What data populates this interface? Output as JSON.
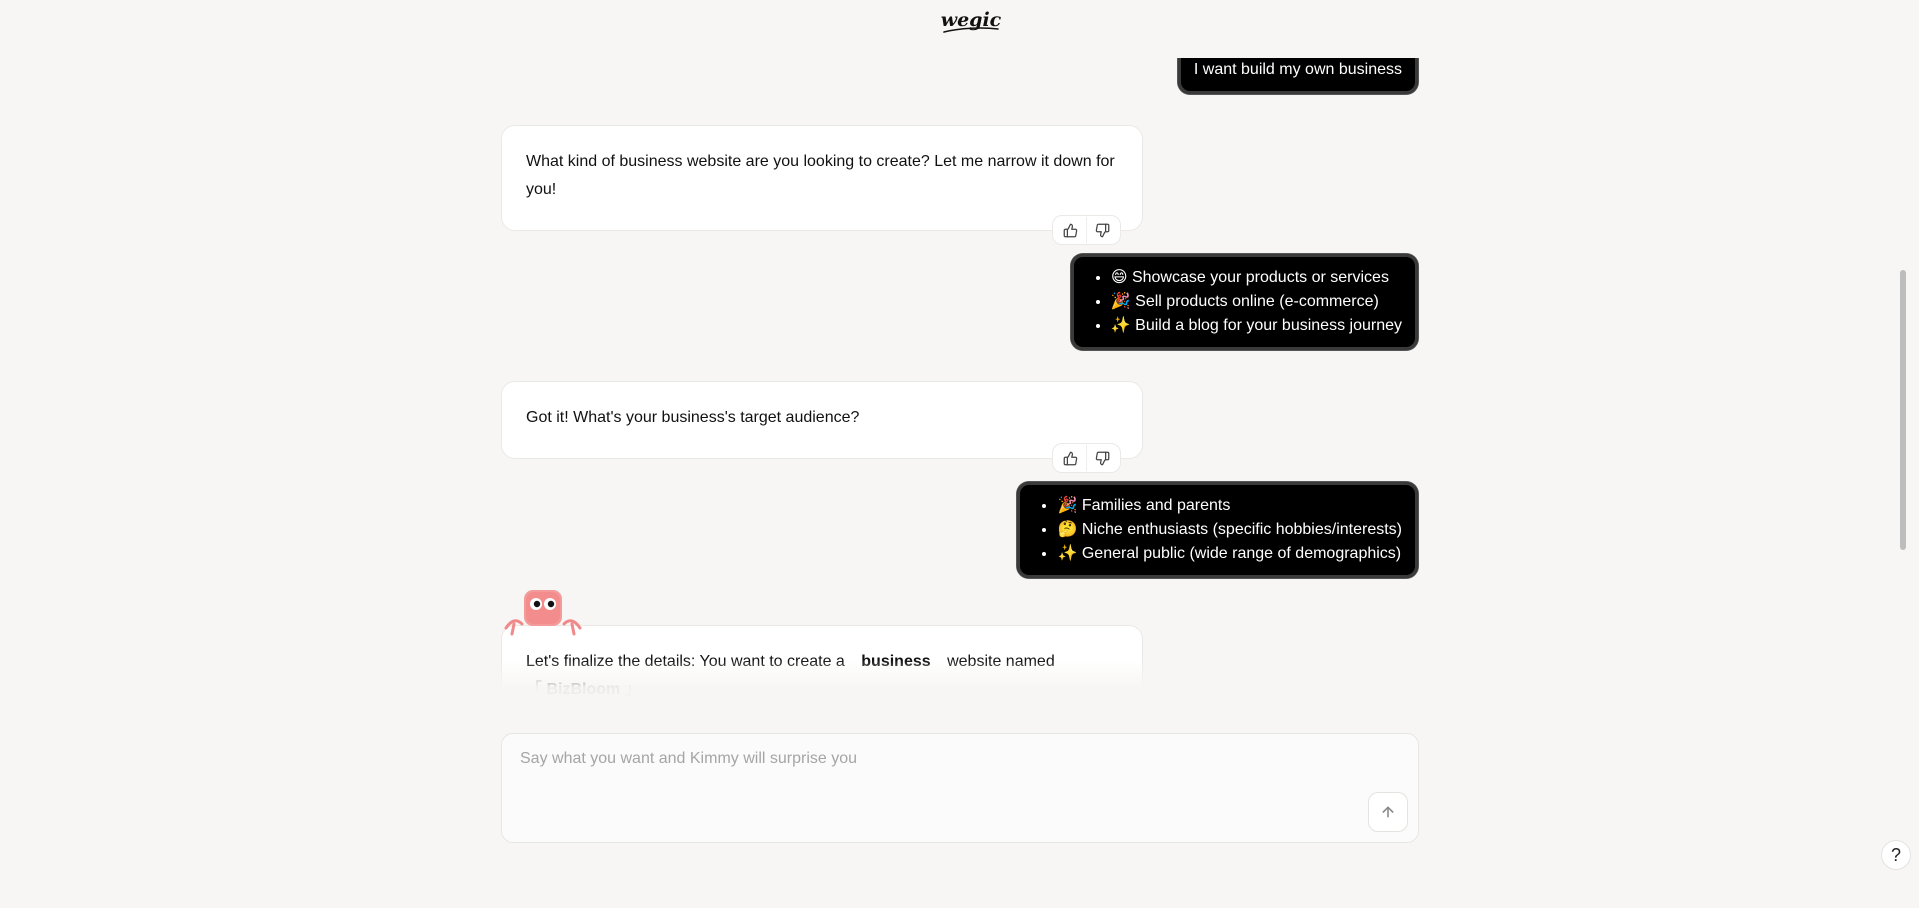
{
  "brand": {
    "logo_text": "Wegic"
  },
  "messages": {
    "user_1": "I want build my own business",
    "bot_1": "What kind of business website are you looking to create? Let me narrow it down for you!",
    "user_2_items": [
      "😄 Showcase your products or services",
      "🎉 Sell products online (e-commerce)",
      "✨ Build a blog for your business journey"
    ],
    "bot_2": "Got it! What's your business's target audience?",
    "user_3_items": [
      "🎉 Families and parents",
      "🤔 Niche enthusiasts (specific hobbies/interests)",
      "✨ General public (wide range of demographics)"
    ],
    "bot_3_prefix": "Let's finalize the details: You want to create a",
    "bot_3_type": "business",
    "bot_3_suffix": "website named",
    "bot_3_open_bracket": "「",
    "bot_3_name": "BizBloom",
    "bot_3_close_bracket": "」"
  },
  "input": {
    "placeholder": "Say what you want and Kimmy will surprise you"
  },
  "help": {
    "label": "?"
  },
  "colors": {
    "background": "#f7f6f4",
    "user_bubble": "#000000",
    "bot_bubble": "#ffffff",
    "mascot": "#f08a8a"
  },
  "icons": {
    "like": "thumbs-up-icon",
    "dislike": "thumbs-down-icon",
    "send": "arrow-up-icon"
  }
}
